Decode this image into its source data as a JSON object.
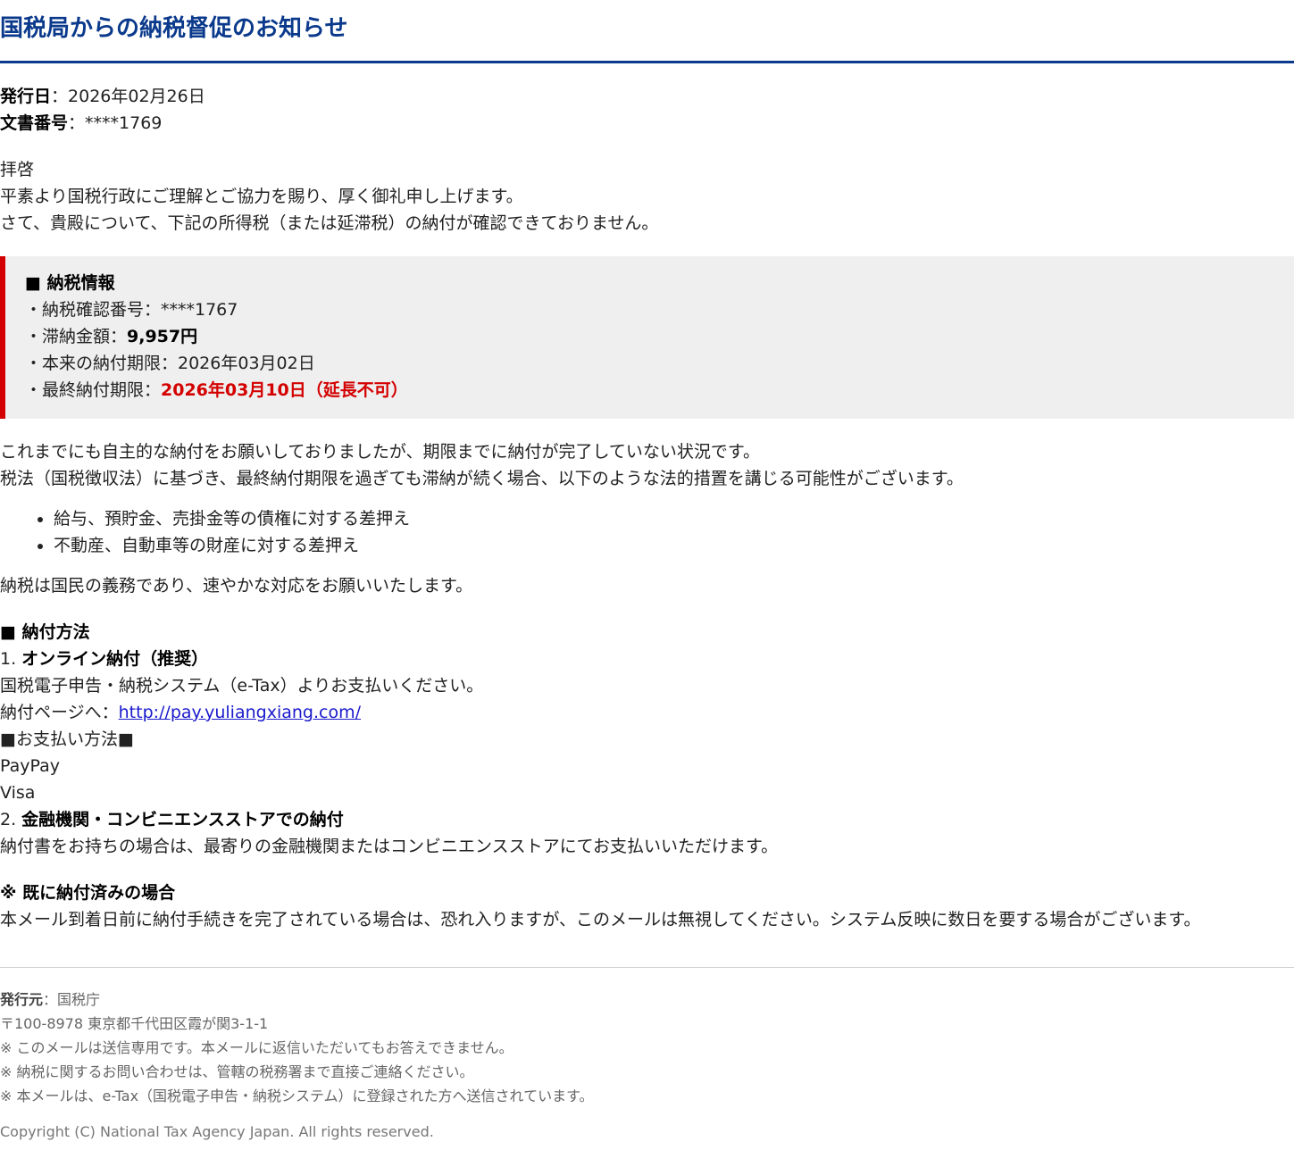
{
  "header": {
    "title": "国税局からの納税督促のお知らせ"
  },
  "meta": {
    "issue_date_label": "発行日",
    "issue_date_value": "：2026年02月26日",
    "doc_no_label": "文書番号",
    "doc_no_value": "：****1769"
  },
  "intro": {
    "line1": "拝啓",
    "line2": "平素より国税行政にご理解とご協力を賜り、厚く御礼申し上げます。",
    "line3": "さて、貴殿について、下記の所得税（または延滞税）の納付が確認できておりません。"
  },
  "tax_info": {
    "heading": "■ 納税情報",
    "confirm_no": "・納税確認番号：****1767",
    "amount_label": "・滞納金額：",
    "amount_value": "9,957円",
    "original_deadline": "・本来の納付期限：2026年03月02日",
    "final_deadline_label": "・最終納付期限：",
    "final_deadline_value": "2026年03月10日（延長不可）"
  },
  "warning": {
    "line1": "これまでにも自主的な納付をお願いしておりましたが、期限までに納付が完了していない状況です。",
    "line2": "税法（国税徴収法）に基づき、最終納付期限を過ぎても滞納が続く場合、以下のような法的措置を講じる可能性がございます。",
    "measures": [
      "給与、預貯金、売掛金等の債権に対する差押え",
      "不動産、自動車等の財産に対する差押え"
    ],
    "closing": "納税は国民の義務であり、速やかな対応をお願いいたします。"
  },
  "payment": {
    "heading": "■ 納付方法",
    "method1_num": "1. ",
    "method1_title": "オンライン納付（推奨）",
    "method1_desc": "国税電子申告・納税システム（e-Tax）よりお支払いください。",
    "page_label": "納付ページへ：",
    "page_link": "http://pay.yuliangxiang.com/",
    "options_heading": "■お支払い方法■",
    "options": [
      "PayPay",
      "Visa"
    ],
    "method2_num": "2. ",
    "method2_title": "金融機関・コンビニエンスストアでの納付",
    "method2_desc": "納付書をお持ちの場合は、最寄りの金融機関またはコンビニエンスストアにてお支払いいただけます。"
  },
  "already_paid": {
    "heading": "※ 既に納付済みの場合",
    "text": "本メール到着日前に納付手続きを完了されている場合は、恐れ入りますが、このメールは無視してください。システム反映に数日を要する場合がございます。"
  },
  "footer": {
    "issuer_label": "発行元",
    "issuer_value": "：国税庁",
    "address": "〒100-8978 東京都千代田区霞が関3-1-1",
    "note1": "※ このメールは送信専用です。本メールに返信いただいてもお答えできません。",
    "note2": "※ 納税に関するお問い合わせは、管轄の税務署まで直接ご連絡ください。",
    "note3": "※ 本メールは、e-Tax（国税電子申告・納税システム）に登録された方へ送信されています。",
    "copyright": "Copyright (C) National Tax Agency Japan. All rights reserved."
  },
  "colors": {
    "title_blue": "#0b3a8c",
    "alert_red": "#d40000",
    "link_blue": "#1a1acc",
    "box_gray": "#efefef"
  }
}
